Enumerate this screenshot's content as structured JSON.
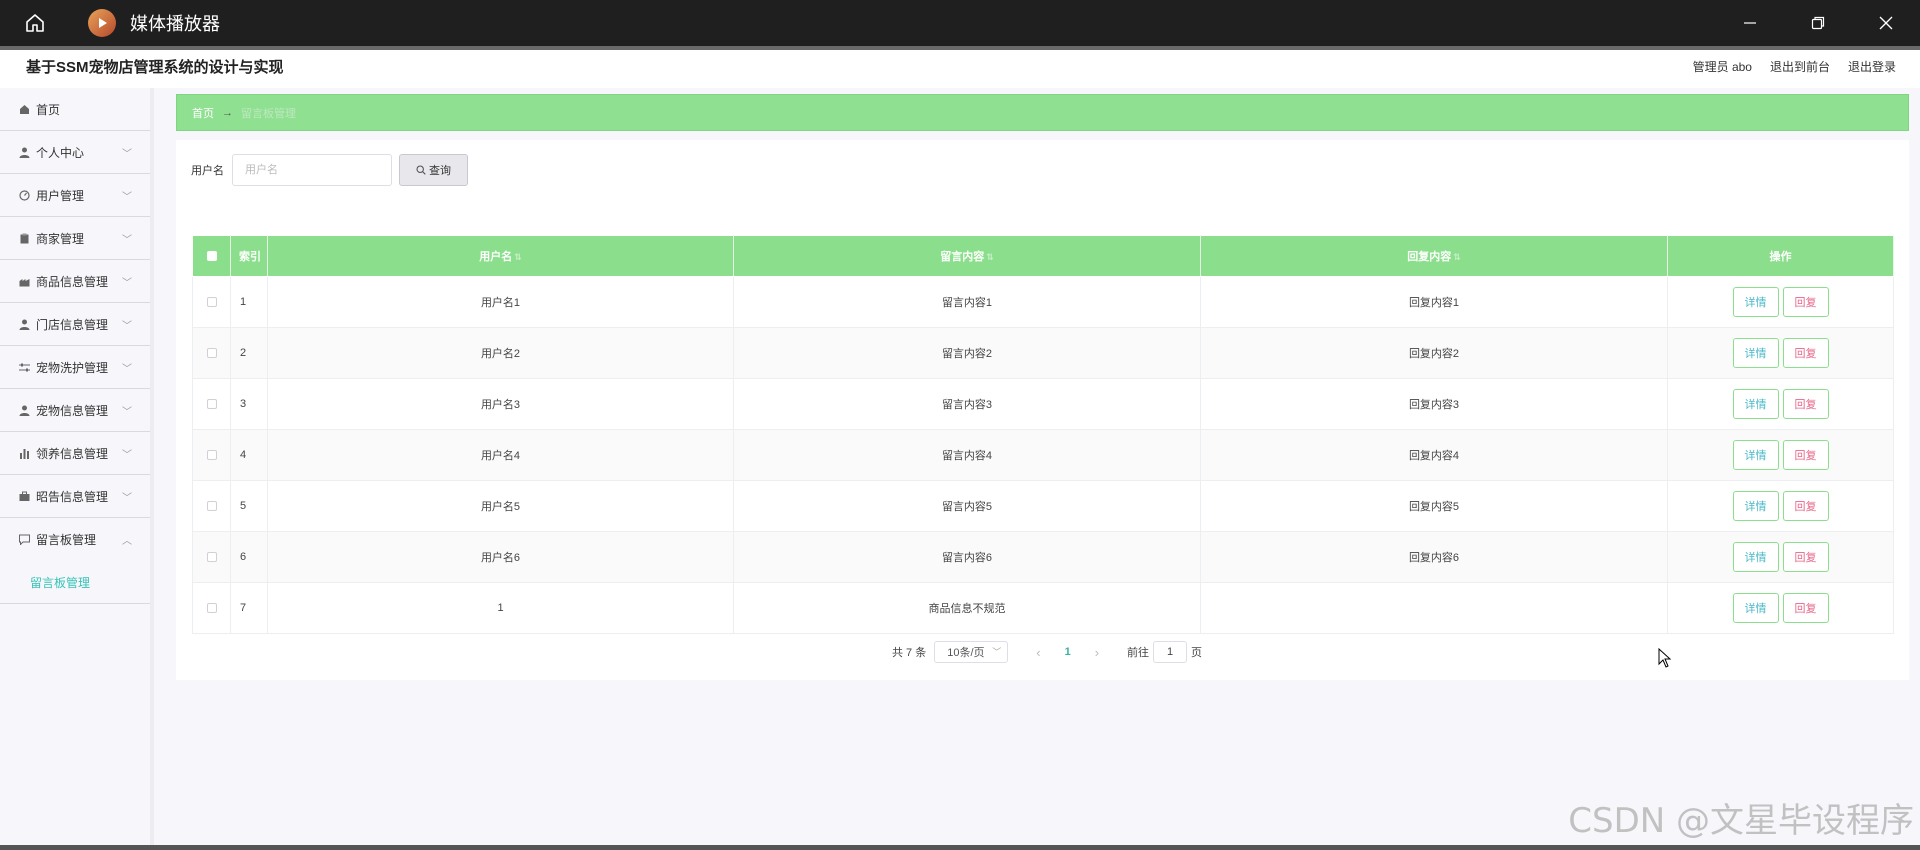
{
  "window": {
    "title": "媒体播放器",
    "minimize": "—",
    "restore": "❐",
    "close": "✕"
  },
  "header": {
    "system_title": "基于SSM宠物店管理系统的设计与实现",
    "user": "管理员 abo",
    "to_front": "退出到前台",
    "logout": "退出登录"
  },
  "sidebar": {
    "items": [
      {
        "label": "首页",
        "icon": "home-icon",
        "has_arrow": false
      },
      {
        "label": "个人中心",
        "icon": "user-icon",
        "has_arrow": true
      },
      {
        "label": "用户管理",
        "icon": "gauge-icon",
        "has_arrow": true
      },
      {
        "label": "商家管理",
        "icon": "clipboard-icon",
        "has_arrow": true
      },
      {
        "label": "商品信息管理",
        "icon": "factory-icon",
        "has_arrow": true
      },
      {
        "label": "门店信息管理",
        "icon": "user-icon",
        "has_arrow": true
      },
      {
        "label": "宠物洗护管理",
        "icon": "sliders-icon",
        "has_arrow": true
      },
      {
        "label": "宠物信息管理",
        "icon": "user-icon",
        "has_arrow": true
      },
      {
        "label": "领养信息管理",
        "icon": "bar-chart-icon",
        "has_arrow": true
      },
      {
        "label": "昭告信息管理",
        "icon": "briefcase-icon",
        "has_arrow": true
      },
      {
        "label": "留言板管理",
        "icon": "message-icon",
        "has_arrow": true,
        "expanded": true
      }
    ],
    "submenu": {
      "label": "留言板管理"
    }
  },
  "breadcrumb": {
    "home": "首页",
    "separator": "→",
    "current": "留言板管理"
  },
  "search": {
    "label": "用户名",
    "placeholder": "用户名",
    "button": "查询"
  },
  "table": {
    "headers": {
      "index": "索引",
      "username": "用户名",
      "content": "留言内容",
      "reply": "回复内容",
      "actions": "操作"
    },
    "rows": [
      {
        "index": "1",
        "username": "用户名1",
        "content": "留言内容1",
        "reply": "回复内容1"
      },
      {
        "index": "2",
        "username": "用户名2",
        "content": "留言内容2",
        "reply": "回复内容2"
      },
      {
        "index": "3",
        "username": "用户名3",
        "content": "留言内容3",
        "reply": "回复内容3"
      },
      {
        "index": "4",
        "username": "用户名4",
        "content": "留言内容4",
        "reply": "回复内容4"
      },
      {
        "index": "5",
        "username": "用户名5",
        "content": "留言内容5",
        "reply": "回复内容5"
      },
      {
        "index": "6",
        "username": "用户名6",
        "content": "留言内容6",
        "reply": "回复内容6"
      },
      {
        "index": "7",
        "username": "1",
        "content": "商品信息不规范",
        "reply": ""
      }
    ],
    "detail_label": "详情",
    "reply_label": "回复"
  },
  "pager": {
    "total": "共 7 条",
    "page_size": "10条/页",
    "current_page": "1",
    "goto_prefix": "前往",
    "goto_value": "1",
    "goto_suffix": "页"
  },
  "watermark": "CSDN @文星毕设程序"
}
